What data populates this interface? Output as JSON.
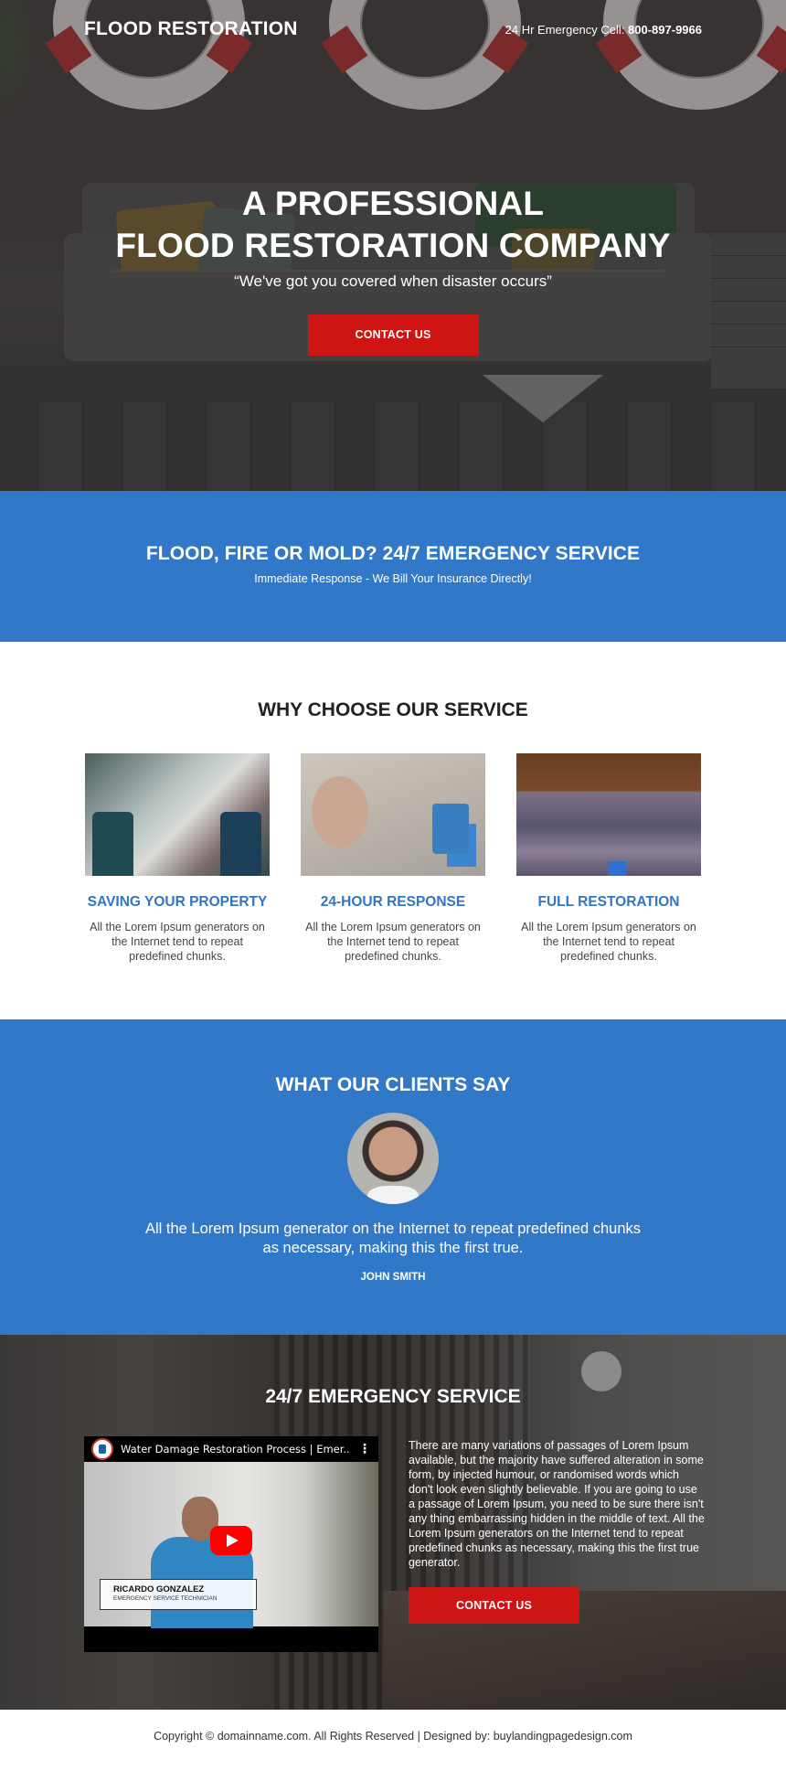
{
  "header": {
    "brand": "FLOOD RESTORATION",
    "emergency_label": "24 Hr Emergency Cell: ",
    "emergency_phone": "800-897-9966"
  },
  "hero": {
    "title_line1": "A PROFESSIONAL",
    "title_line2": "FLOOD RESTORATION COMPANY",
    "subtitle": "“We've got you covered when disaster occurs”",
    "cta_label": "CONTACT US"
  },
  "band": {
    "title": "FLOOD, FIRE OR MOLD? 24/7 EMERGENCY SERVICE",
    "subtitle": "Immediate Response - We Bill Your Insurance Directly!"
  },
  "services": {
    "title": "WHY CHOOSE OUR SERVICE",
    "items": [
      {
        "heading": "SAVING YOUR PROPERTY",
        "text": "All the Lorem Ipsum generators on the Internet tend to repeat predefined chunks.",
        "image": "property-drying-equipment-photo"
      },
      {
        "heading": "24-HOUR RESPONSE",
        "text": "All the Lorem Ipsum generators on the Internet tend to repeat predefined chunks.",
        "image": "technician-selfie-photo"
      },
      {
        "heading": "FULL RESTORATION",
        "text": "All the Lorem Ipsum generators on the Internet tend to repeat predefined chunks.",
        "image": "carpet-drying-hall-photo"
      }
    ]
  },
  "testimonial": {
    "title": "WHAT OUR CLIENTS SAY",
    "quote": "All the Lorem Ipsum generator on the Internet to repeat predefined chunks as necessary, making this the first true.",
    "author": "JOHN SMITH"
  },
  "emergency": {
    "title": "24/7 EMERGENCY SERVICE",
    "video": {
      "title": "Water Damage Restoration Process | Emer...",
      "person_name": "RICARDO GONZALEZ",
      "person_role": "EMERGENCY SERVICE TECHNICIAN"
    },
    "text": "There are many variations of passages of Lorem Ipsum available, but the majority have suffered alteration in some form, by injected humour, or randomised words which don't look even slightly believable. If you are going to use a passage of Lorem Ipsum, you need to be sure there isn't any thing embarrassing hidden in the middle of text. All the Lorem Ipsum generators on the Internet tend to repeat predefined chunks as necessary, making this the first true generator.",
    "cta_label": "CONTACT US"
  },
  "footer": {
    "text": "Copyright © domainname.com. All Rights Reserved | Designed by: buylandingpagedesign.com"
  },
  "colors": {
    "accent_blue": "#3178c8",
    "cta_red": "#cf1414",
    "heading_dark": "#222222"
  }
}
